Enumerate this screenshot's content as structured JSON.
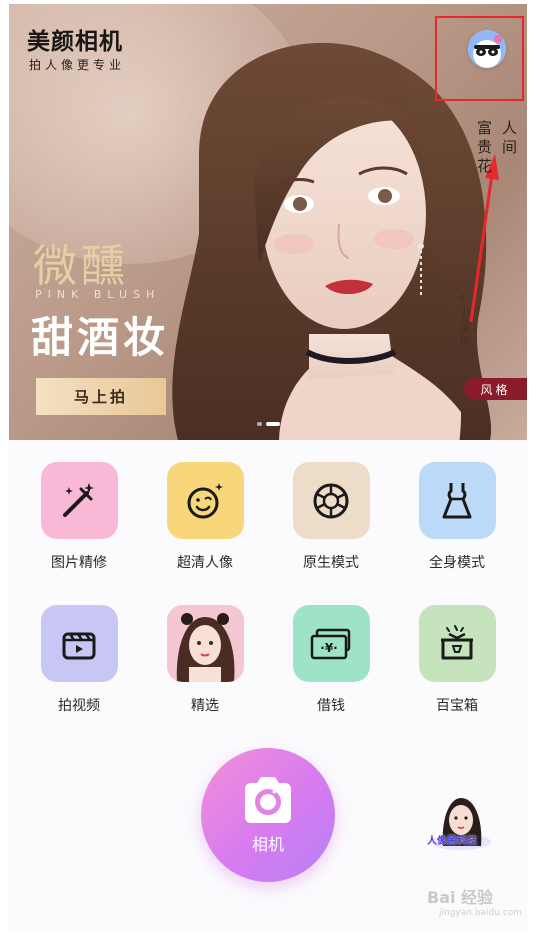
{
  "banner": {
    "brand_title": "美颜相机",
    "brand_subtitle": "拍人像更专业",
    "vertical_line_1": "人间",
    "vertical_line_2": "富贵花",
    "headline_1": "微醺",
    "headline_en": "PINK BLUSH",
    "headline_2": "甜酒妆",
    "cta_label": "马上拍",
    "credit": "©小九学妹",
    "style_tag": "风格",
    "page_count": 2,
    "active_page": 2
  },
  "grid": {
    "items": [
      {
        "label": "图片精修",
        "icon": "magic-wand-icon",
        "color": "#f9b9d6"
      },
      {
        "label": "超清人像",
        "icon": "smile-face-icon",
        "color": "#f8d77a"
      },
      {
        "label": "原生模式",
        "icon": "aperture-icon",
        "color": "#ecdcc8"
      },
      {
        "label": "全身模式",
        "icon": "dress-icon",
        "color": "#bcd9f7"
      },
      {
        "label": "拍视频",
        "icon": "clapperboard-icon",
        "color": "#c8c6f5"
      },
      {
        "label": "精选",
        "icon": "portrait-thumbnail",
        "color": "#f6b4c8"
      },
      {
        "label": "借钱",
        "icon": "money-bills-icon",
        "color": "#9ee3c8"
      },
      {
        "label": "百宝箱",
        "icon": "treasure-box-icon",
        "color": "#c5e3bd"
      }
    ]
  },
  "camera": {
    "label": "相机",
    "icon": "camera-icon"
  },
  "promo": {
    "label": "人像黑科技"
  },
  "watermark": {
    "text": "Bai 经验",
    "sub": "jingyan.baidu.com"
  },
  "colors": {
    "annotation_red": "#e8272d",
    "cta_gold": "#e9c797",
    "style_tag": "#8b1a2a",
    "camera_pink": "#f290d6",
    "camera_purple": "#b680f5"
  }
}
